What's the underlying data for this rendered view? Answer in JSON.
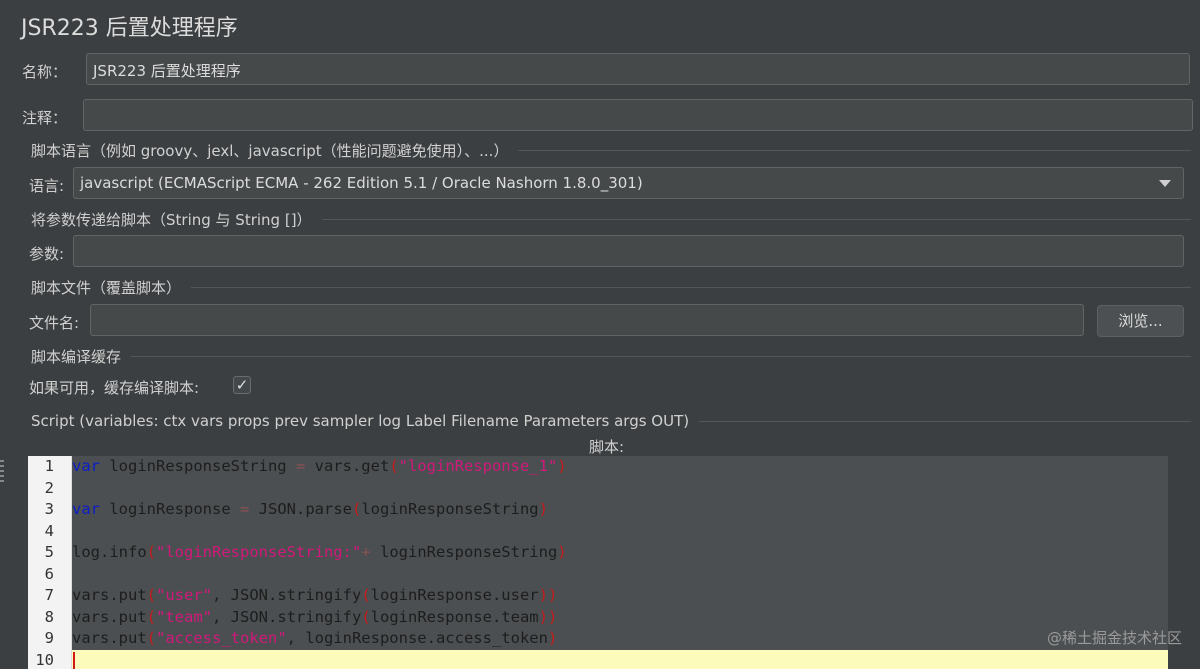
{
  "header": {
    "title": "JSR223 后置处理程序"
  },
  "name_row": {
    "label": "名称：",
    "value": "JSR223 后置处理程序"
  },
  "comment_row": {
    "label": "注释：",
    "value": ""
  },
  "lang_section": {
    "title": "脚本语言（例如 groovy、jexl、javascript（性能问题避免使用）、...）"
  },
  "lang_row": {
    "label": "语言:",
    "value": "javascript     (ECMAScript ECMA - 262 Edition 5.1 / Oracle Nashorn 1.8.0_301)"
  },
  "params_section": {
    "title": "将参数传递给脚本（String 与 String []）"
  },
  "params_row": {
    "label": "参数:",
    "value": ""
  },
  "file_section": {
    "title": "脚本文件（覆盖脚本）"
  },
  "file_row": {
    "label": "文件名:",
    "value": "",
    "browse_label": "浏览..."
  },
  "cache_section": {
    "title": "脚本编译缓存"
  },
  "cache_row": {
    "label": "如果可用，缓存编译脚本:",
    "checked": true,
    "check_glyph": "✓"
  },
  "script_section": {
    "title": "Script (variables: ctx vars props prev sampler log Label Filename Parameters args OUT)"
  },
  "script_label": "脚本:",
  "editor": {
    "current_line": 10,
    "lines": [
      {
        "no": "1",
        "tokens": [
          [
            "kw",
            "var"
          ],
          [
            "t",
            " loginResponseString "
          ],
          [
            "op",
            "="
          ],
          [
            "t",
            " vars.get"
          ],
          [
            "br",
            "("
          ],
          [
            "str",
            "\"loginResponse_1\""
          ],
          [
            "br",
            ")"
          ]
        ]
      },
      {
        "no": "2",
        "tokens": []
      },
      {
        "no": "3",
        "tokens": [
          [
            "kw",
            "var"
          ],
          [
            "t",
            " loginResponse "
          ],
          [
            "op",
            "="
          ],
          [
            "t",
            " JSON.parse"
          ],
          [
            "br",
            "("
          ],
          [
            "t",
            "loginResponseString"
          ],
          [
            "br",
            ")"
          ]
        ]
      },
      {
        "no": "4",
        "tokens": []
      },
      {
        "no": "5",
        "tokens": [
          [
            "t",
            "log.info"
          ],
          [
            "br",
            "("
          ],
          [
            "str",
            "\"loginResponseString:\""
          ],
          [
            "op",
            "+"
          ],
          [
            "t",
            " loginResponseString"
          ],
          [
            "br",
            ")"
          ]
        ]
      },
      {
        "no": "6",
        "tokens": []
      },
      {
        "no": "7",
        "tokens": [
          [
            "t",
            "vars.put"
          ],
          [
            "br",
            "("
          ],
          [
            "str",
            "\"user\""
          ],
          [
            "t",
            ", JSON.stringify"
          ],
          [
            "br",
            "("
          ],
          [
            "t",
            "loginResponse.user"
          ],
          [
            "br",
            "))"
          ]
        ]
      },
      {
        "no": "8",
        "tokens": [
          [
            "t",
            "vars.put"
          ],
          [
            "br",
            "("
          ],
          [
            "str",
            "\"team\""
          ],
          [
            "t",
            ", JSON.stringify"
          ],
          [
            "br",
            "("
          ],
          [
            "t",
            "loginResponse.team"
          ],
          [
            "br",
            "))"
          ]
        ]
      },
      {
        "no": "9",
        "tokens": [
          [
            "t",
            "vars.put"
          ],
          [
            "br",
            "("
          ],
          [
            "str",
            "\"access_token\""
          ],
          [
            "t",
            ", loginResponse.access_token"
          ],
          [
            "br",
            ")"
          ]
        ]
      },
      {
        "no": "10",
        "tokens": []
      }
    ]
  },
  "watermark": "@稀土掘金技术社区",
  "colors": {
    "background": "#3c3f41",
    "field": "#45494a",
    "editor_gutter": "#f3f3f3",
    "current_line": "#fdfbbb",
    "keyword": "#0b1ec8",
    "string": "#d0197a"
  }
}
